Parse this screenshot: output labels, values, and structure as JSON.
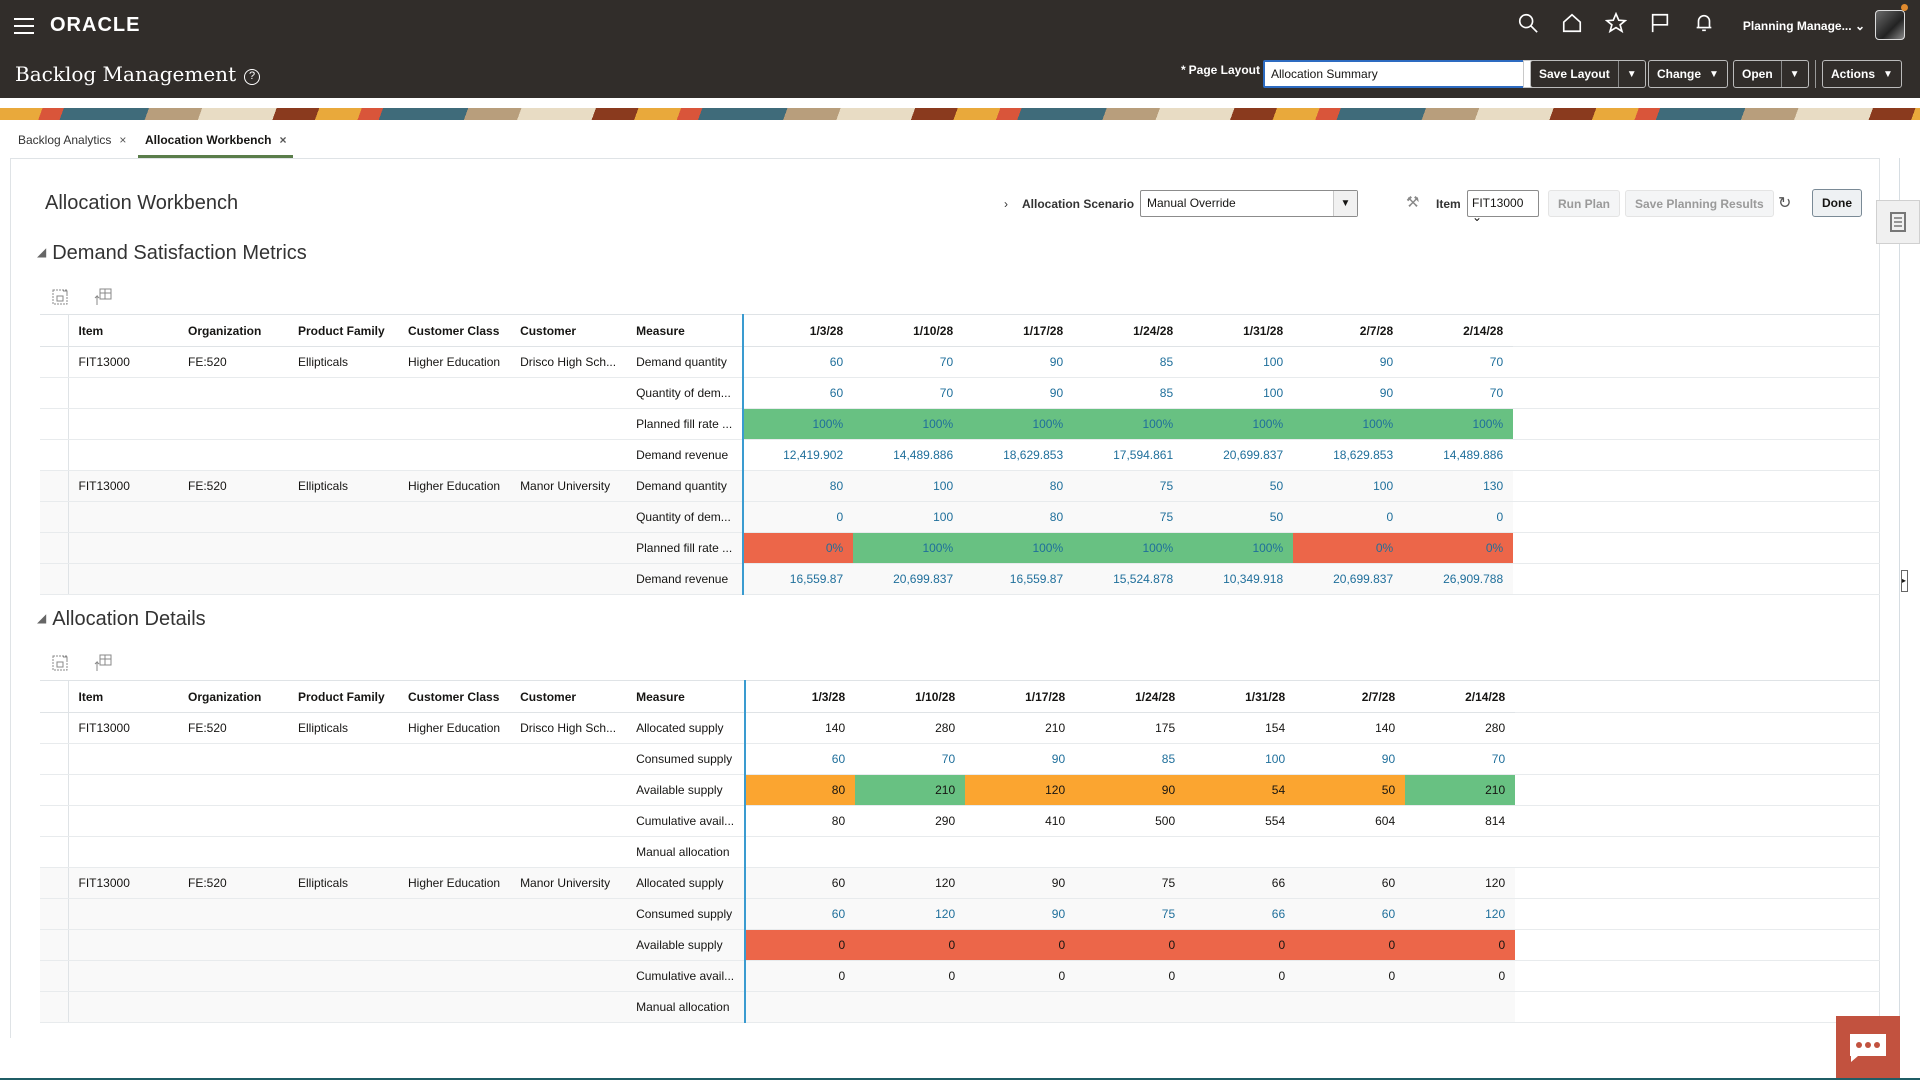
{
  "app": {
    "brand": "ORACLE",
    "page_title": "Backlog Management",
    "user_name": "Planning Manage...",
    "global_icons": [
      "search-icon",
      "home-icon",
      "favorites-star-icon",
      "flag-icon",
      "bell-icon"
    ]
  },
  "header": {
    "page_layout_required": "*",
    "page_layout_label": "Page Layout",
    "page_layout_value": "Allocation Summary",
    "save_layout": "Save Layout",
    "change": "Change",
    "open": "Open",
    "actions": "Actions"
  },
  "tabs": [
    {
      "label": "Backlog Analytics",
      "active": false
    },
    {
      "label": "Allocation Workbench",
      "active": true
    }
  ],
  "workbench": {
    "title": "Allocation Workbench",
    "scenario_label": "Allocation Scenario",
    "scenario_value": "Manual Override",
    "item_label": "Item",
    "item_value": "FIT13000",
    "run_plan": "Run Plan",
    "save_results": "Save Planning Results",
    "done": "Done"
  },
  "colors": {
    "green": "#68c182",
    "red": "#ec6649",
    "orange": "#fba530",
    "link": "#1f6f9b",
    "header_bg": "#312d2a"
  },
  "columns": [
    "Item",
    "Organization",
    "Product Family",
    "Customer Class",
    "Customer",
    "Measure"
  ],
  "dates": [
    "1/3/28",
    "1/10/28",
    "1/17/28",
    "1/24/28",
    "1/31/28",
    "2/7/28",
    "2/14/28"
  ],
  "demand": {
    "title": "Demand Satisfaction Metrics",
    "rows": [
      {
        "item": "FIT13000",
        "org": "FE:520",
        "family": "Ellipticals",
        "cls": "Higher Education",
        "customer": "Drisco High Sch...",
        "measure": "Demand quantity",
        "values": [
          "60",
          "70",
          "90",
          "85",
          "100",
          "90",
          "70"
        ],
        "style": "link",
        "colors": []
      },
      {
        "item": "",
        "org": "",
        "family": "",
        "cls": "",
        "customer": "",
        "measure": "Quantity of dem...",
        "values": [
          "60",
          "70",
          "90",
          "85",
          "100",
          "90",
          "70"
        ],
        "style": "link",
        "colors": []
      },
      {
        "item": "",
        "org": "",
        "family": "",
        "cls": "",
        "customer": "",
        "measure": "Planned fill rate ...",
        "values": [
          "100%",
          "100%",
          "100%",
          "100%",
          "100%",
          "100%",
          "100%"
        ],
        "style": "link",
        "colors": [
          "green",
          "green",
          "green",
          "green",
          "green",
          "green",
          "green"
        ]
      },
      {
        "item": "",
        "org": "",
        "family": "",
        "cls": "",
        "customer": "",
        "measure": "Demand revenue",
        "values": [
          "12,419.902",
          "14,489.886",
          "18,629.853",
          "17,594.861",
          "20,699.837",
          "18,629.853",
          "14,489.886"
        ],
        "style": "link",
        "colors": []
      },
      {
        "item": "FIT13000",
        "org": "FE:520",
        "family": "Ellipticals",
        "cls": "Higher Education",
        "customer": "Manor University",
        "measure": "Demand quantity",
        "values": [
          "80",
          "100",
          "80",
          "75",
          "50",
          "100",
          "130"
        ],
        "style": "link",
        "colors": []
      },
      {
        "item": "",
        "org": "",
        "family": "",
        "cls": "",
        "customer": "",
        "measure": "Quantity of dem...",
        "values": [
          "0",
          "100",
          "80",
          "75",
          "50",
          "0",
          "0"
        ],
        "style": "link",
        "colors": []
      },
      {
        "item": "",
        "org": "",
        "family": "",
        "cls": "",
        "customer": "",
        "measure": "Planned fill rate ...",
        "values": [
          "0%",
          "100%",
          "100%",
          "100%",
          "100%",
          "0%",
          "0%"
        ],
        "style": "link",
        "colors": [
          "red",
          "green",
          "green",
          "green",
          "green",
          "red",
          "red"
        ]
      },
      {
        "item": "",
        "org": "",
        "family": "",
        "cls": "",
        "customer": "",
        "measure": "Demand revenue",
        "values": [
          "16,559.87",
          "20,699.837",
          "16,559.87",
          "15,524.878",
          "10,349.918",
          "20,699.837",
          "26,909.788"
        ],
        "style": "link",
        "colors": []
      }
    ]
  },
  "allocation": {
    "title": "Allocation Details",
    "rows": [
      {
        "item": "FIT13000",
        "org": "FE:520",
        "family": "Ellipticals",
        "cls": "Higher Education",
        "customer": "Drisco High Sch...",
        "measure": "Allocated supply",
        "values": [
          "140",
          "280",
          "210",
          "175",
          "154",
          "140",
          "280"
        ],
        "style": "plain",
        "colors": []
      },
      {
        "item": "",
        "org": "",
        "family": "",
        "cls": "",
        "customer": "",
        "measure": "Consumed supply",
        "values": [
          "60",
          "70",
          "90",
          "85",
          "100",
          "90",
          "70"
        ],
        "style": "link",
        "colors": []
      },
      {
        "item": "",
        "org": "",
        "family": "",
        "cls": "",
        "customer": "",
        "measure": "Available supply",
        "values": [
          "80",
          "210",
          "120",
          "90",
          "54",
          "50",
          "210"
        ],
        "style": "plain",
        "colors": [
          "orange",
          "green",
          "orange",
          "orange",
          "orange",
          "orange",
          "green"
        ]
      },
      {
        "item": "",
        "org": "",
        "family": "",
        "cls": "",
        "customer": "",
        "measure": "Cumulative avail...",
        "values": [
          "80",
          "290",
          "410",
          "500",
          "554",
          "604",
          "814"
        ],
        "style": "plain",
        "colors": []
      },
      {
        "item": "",
        "org": "",
        "family": "",
        "cls": "",
        "customer": "",
        "measure": "Manual allocation",
        "values": [
          "",
          "",
          "",
          "",
          "",
          "",
          ""
        ],
        "style": "plain",
        "colors": []
      },
      {
        "item": "FIT13000",
        "org": "FE:520",
        "family": "Ellipticals",
        "cls": "Higher Education",
        "customer": "Manor University",
        "measure": "Allocated supply",
        "values": [
          "60",
          "120",
          "90",
          "75",
          "66",
          "60",
          "120"
        ],
        "style": "plain",
        "colors": []
      },
      {
        "item": "",
        "org": "",
        "family": "",
        "cls": "",
        "customer": "",
        "measure": "Consumed supply",
        "values": [
          "60",
          "120",
          "90",
          "75",
          "66",
          "60",
          "120"
        ],
        "style": "link",
        "colors": []
      },
      {
        "item": "",
        "org": "",
        "family": "",
        "cls": "",
        "customer": "",
        "measure": "Available supply",
        "values": [
          "0",
          "0",
          "0",
          "0",
          "0",
          "0",
          "0"
        ],
        "style": "plain",
        "colors": [
          "red",
          "red",
          "red",
          "red",
          "red",
          "red",
          "red"
        ]
      },
      {
        "item": "",
        "org": "",
        "family": "",
        "cls": "",
        "customer": "",
        "measure": "Cumulative avail...",
        "values": [
          "0",
          "0",
          "0",
          "0",
          "0",
          "0",
          "0"
        ],
        "style": "plain",
        "colors": []
      },
      {
        "item": "",
        "org": "",
        "family": "",
        "cls": "",
        "customer": "",
        "measure": "Manual allocation",
        "values": [
          "",
          "",
          "",
          "",
          "",
          "",
          ""
        ],
        "style": "plain",
        "colors": []
      }
    ]
  }
}
